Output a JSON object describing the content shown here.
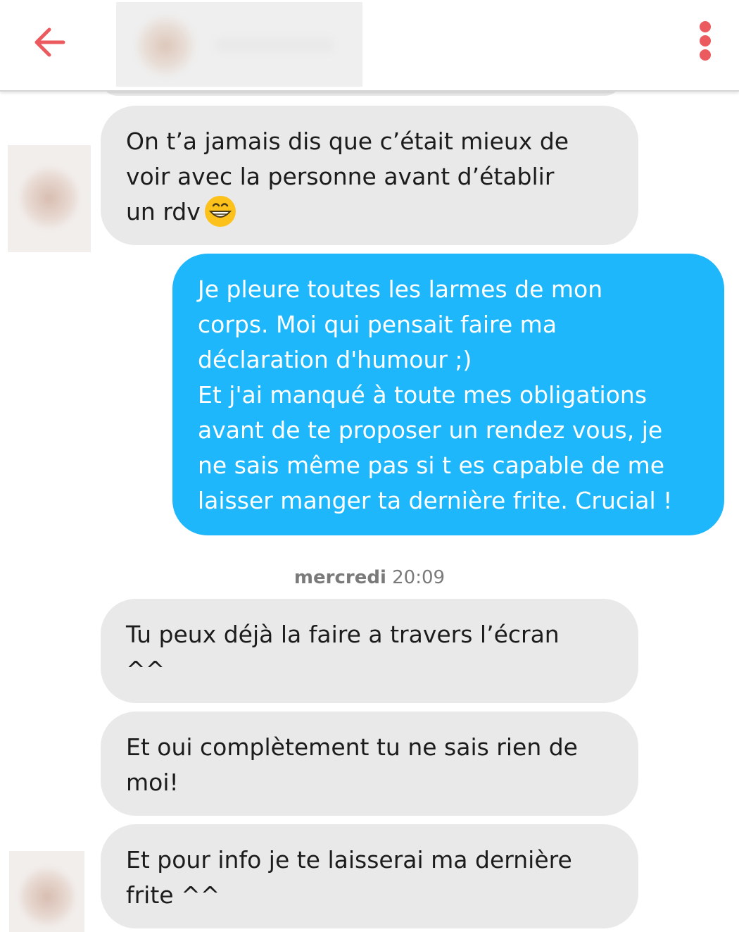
{
  "header": {
    "back_icon": "arrow-left-icon",
    "menu_icon": "vertical-dots-icon",
    "accent_color": "#ea5a5e"
  },
  "messages": [
    {
      "direction": "incoming",
      "text": "On t’a jamais dis que c’était mieux de\nvoir avec la personne avant d’établir\nun rdv",
      "emoji": "grinning-face-icon"
    },
    {
      "direction": "outgoing",
      "text": "Je pleure toutes les larmes de mon\ncorps. Moi qui pensait faire ma\ndéclaration d'humour ;)\nEt j'ai manqué à toute mes obligations\navant de te proposer un rendez vous, je\nne sais même pas si t es capable de me\nlaisser manger ta dernière frite. Crucial !"
    },
    {
      "direction": "incoming",
      "text": "Tu peux déjà la faire a travers l’écran\n^^"
    },
    {
      "direction": "incoming",
      "text": "Et oui complètement tu ne sais rien de\nmoi!"
    },
    {
      "direction": "incoming",
      "text": "Et pour info je te laisserai ma dernière\nfrite ^^"
    }
  ],
  "timestamp": {
    "day": "mercredi",
    "time": "20:09"
  },
  "colors": {
    "incoming_bubble": "#e9e9e9",
    "outgoing_bubble": "#1eb7fb",
    "incoming_text": "#1c1c1c",
    "outgoing_text": "#ffffff"
  }
}
